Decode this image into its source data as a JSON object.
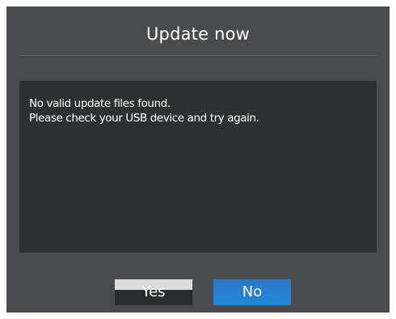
{
  "dialog": {
    "title": "Update now",
    "message_lines": [
      "No valid update files found.",
      "Please check your USB device and try again."
    ],
    "buttons": {
      "yes_label": "Yes",
      "no_label": "No"
    }
  },
  "colors": {
    "dialog_bg": "#4a4b4e",
    "message_bg": "#2f3033",
    "focus_button": "#1f88d6"
  }
}
